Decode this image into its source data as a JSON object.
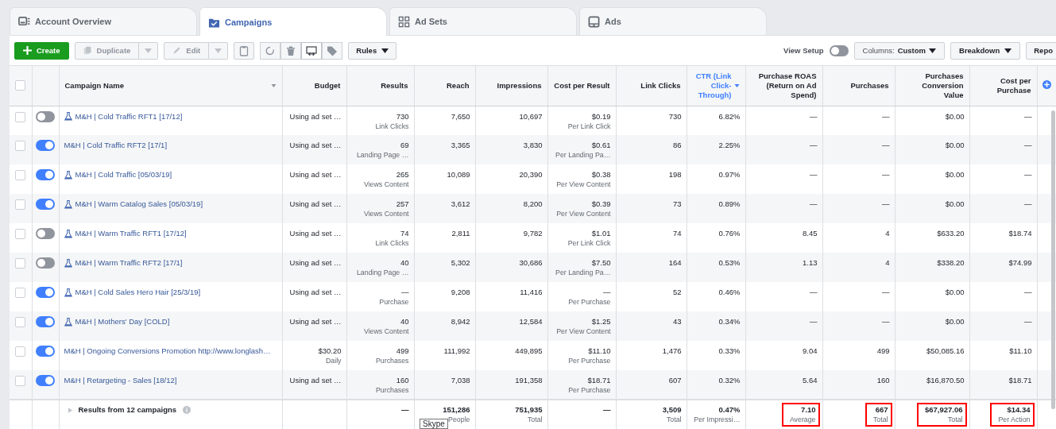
{
  "tabs": [
    {
      "label": "Account Overview",
      "selected": false
    },
    {
      "label": "Campaigns",
      "selected": true
    },
    {
      "label": "Ad Sets",
      "selected": false
    },
    {
      "label": "Ads",
      "selected": false
    }
  ],
  "toolbar": {
    "create": {
      "label": "Create"
    },
    "duplicate": {
      "label": "Duplicate",
      "disabled": true
    },
    "edit": {
      "label": "Edit",
      "disabled": true
    },
    "icon_buttons": [
      {
        "disabled": true
      },
      {
        "disabled": true
      },
      {
        "disabled": true
      },
      {
        "disabled": false
      },
      {
        "disabled": true
      }
    ],
    "rules": {
      "label": "Rules"
    },
    "view_setup": {
      "label": "View Setup",
      "on": false
    },
    "columns": {
      "label": "Columns:",
      "value": "Custom"
    },
    "breakdown": {
      "label": "Breakdown"
    },
    "report": {
      "label": "Repo"
    }
  },
  "table": {
    "header_checkbox": {
      "checked": false
    },
    "columns": [
      {
        "label": "Campaign Name",
        "caret": true,
        "sorted": false
      },
      {
        "label": "Budget",
        "caret": false,
        "sorted": false
      },
      {
        "label": "Results",
        "caret": false,
        "sorted": false
      },
      {
        "label": "Reach",
        "caret": false,
        "sorted": false
      },
      {
        "label": "Impressions",
        "caret": false,
        "sorted": false
      },
      {
        "label": "Cost per Result",
        "caret": false,
        "sorted": false
      },
      {
        "label": "Link Clicks",
        "caret": false,
        "sorted": false
      },
      {
        "label": "CTR (Link Click-Through)",
        "caret": true,
        "sorted": true
      },
      {
        "label": "Purchase ROAS (Return on Ad Spend)",
        "caret": false,
        "sorted": false
      },
      {
        "label": "Purchases",
        "caret": false,
        "sorted": false
      },
      {
        "label": "Purchases Conversion Value",
        "caret": false,
        "sorted": false
      },
      {
        "label": "Cost per Purchase",
        "caret": false,
        "sorted": false
      }
    ],
    "rows": [
      {
        "selected": false,
        "on": false,
        "experiment": true,
        "cells": [
          {
            "value": "M&H | Cold Traffic RFT1 [17/12]"
          },
          {
            "value": "Using ad set …"
          },
          {
            "value": "730",
            "caption": "Link Clicks"
          },
          {
            "value": "7,650"
          },
          {
            "value": "10,697"
          },
          {
            "value": "$0.19",
            "caption": "Per Link Click"
          },
          {
            "value": "730"
          },
          {
            "value": "6.82%"
          },
          {
            "value": "—"
          },
          {
            "value": "—"
          },
          {
            "value": "$0.00"
          },
          {
            "value": "—"
          }
        ]
      },
      {
        "selected": false,
        "on": true,
        "experiment": false,
        "cells": [
          {
            "value": "M&H | Cold Traffic RFT2 [17/1]"
          },
          {
            "value": "Using ad set …"
          },
          {
            "value": "69",
            "caption": "Landing Page …"
          },
          {
            "value": "3,365"
          },
          {
            "value": "3,830"
          },
          {
            "value": "$0.61",
            "caption": "Per Landing Pa…"
          },
          {
            "value": "86"
          },
          {
            "value": "2.25%"
          },
          {
            "value": "—"
          },
          {
            "value": "—"
          },
          {
            "value": "$0.00"
          },
          {
            "value": "—"
          }
        ]
      },
      {
        "selected": false,
        "on": true,
        "experiment": true,
        "cells": [
          {
            "value": "M&H | Cold Traffic [05/03/19]"
          },
          {
            "value": "Using ad set …"
          },
          {
            "value": "265",
            "caption": "Views Content"
          },
          {
            "value": "10,089"
          },
          {
            "value": "20,390"
          },
          {
            "value": "$0.38",
            "caption": "Per View Content"
          },
          {
            "value": "198"
          },
          {
            "value": "0.97%"
          },
          {
            "value": "—"
          },
          {
            "value": "—"
          },
          {
            "value": "$0.00"
          },
          {
            "value": "—"
          }
        ]
      },
      {
        "selected": false,
        "on": true,
        "experiment": true,
        "cells": [
          {
            "value": "M&H | Warm Catalog Sales [05/03/19]"
          },
          {
            "value": "Using ad set …"
          },
          {
            "value": "257",
            "caption": "Views Content"
          },
          {
            "value": "3,612"
          },
          {
            "value": "8,200"
          },
          {
            "value": "$0.39",
            "caption": "Per View Content"
          },
          {
            "value": "73"
          },
          {
            "value": "0.89%"
          },
          {
            "value": "—"
          },
          {
            "value": "—"
          },
          {
            "value": "$0.00"
          },
          {
            "value": "—"
          }
        ]
      },
      {
        "selected": false,
        "on": false,
        "experiment": true,
        "cells": [
          {
            "value": "M&H | Warm Traffic RFT1 [17/12]"
          },
          {
            "value": "Using ad set …"
          },
          {
            "value": "74",
            "caption": "Link Clicks"
          },
          {
            "value": "2,811"
          },
          {
            "value": "9,782"
          },
          {
            "value": "$1.01",
            "caption": "Per Link Click"
          },
          {
            "value": "74"
          },
          {
            "value": "0.76%"
          },
          {
            "value": "8.45"
          },
          {
            "value": "4"
          },
          {
            "value": "$633.20"
          },
          {
            "value": "$18.74"
          }
        ]
      },
      {
        "selected": false,
        "on": false,
        "experiment": true,
        "cells": [
          {
            "value": "M&H | Warm Traffic RFT2 [17/1]"
          },
          {
            "value": "Using ad set …"
          },
          {
            "value": "40",
            "caption": "Landing Page …"
          },
          {
            "value": "5,302"
          },
          {
            "value": "30,686"
          },
          {
            "value": "$7.50",
            "caption": "Per Landing Pa…"
          },
          {
            "value": "164"
          },
          {
            "value": "0.53%"
          },
          {
            "value": "1.13"
          },
          {
            "value": "4"
          },
          {
            "value": "$338.20"
          },
          {
            "value": "$74.99"
          }
        ]
      },
      {
        "selected": false,
        "on": true,
        "experiment": true,
        "cells": [
          {
            "value": "M&H | Cold Sales Hero Hair [25/3/19]"
          },
          {
            "value": "Using ad set …"
          },
          {
            "value": "—",
            "caption": "Purchase"
          },
          {
            "value": "9,208"
          },
          {
            "value": "11,416"
          },
          {
            "value": "—",
            "caption": "Per Purchase"
          },
          {
            "value": "52"
          },
          {
            "value": "0.46%"
          },
          {
            "value": "—"
          },
          {
            "value": "—"
          },
          {
            "value": "$0.00"
          },
          {
            "value": "—"
          }
        ]
      },
      {
        "selected": false,
        "on": true,
        "experiment": true,
        "cells": [
          {
            "value": "M&H | Mothers' Day [COLD]"
          },
          {
            "value": "Using ad set …"
          },
          {
            "value": "40",
            "caption": "Views Content"
          },
          {
            "value": "8,942"
          },
          {
            "value": "12,584"
          },
          {
            "value": "$1.25",
            "caption": "Per View Content"
          },
          {
            "value": "43"
          },
          {
            "value": "0.34%"
          },
          {
            "value": "—"
          },
          {
            "value": "—"
          },
          {
            "value": "$0.00"
          },
          {
            "value": "—"
          }
        ]
      },
      {
        "selected": false,
        "on": true,
        "experiment": false,
        "cells": [
          {
            "value": "M&H | Ongoing Conversions Promotion http://www.longlash…"
          },
          {
            "value": "$30.20",
            "caption": "Daily"
          },
          {
            "value": "499",
            "caption": "Purchases"
          },
          {
            "value": "111,992"
          },
          {
            "value": "449,895"
          },
          {
            "value": "$11.10",
            "caption": "Per Purchase"
          },
          {
            "value": "1,476"
          },
          {
            "value": "0.33%"
          },
          {
            "value": "9.04"
          },
          {
            "value": "499"
          },
          {
            "value": "$50,085.16"
          },
          {
            "value": "$11.10"
          }
        ]
      },
      {
        "selected": false,
        "on": true,
        "experiment": false,
        "cells": [
          {
            "value": "M&H | Retargeting - Sales [18/12]"
          },
          {
            "value": "Using ad set …"
          },
          {
            "value": "160",
            "caption": "Purchases"
          },
          {
            "value": "7,038"
          },
          {
            "value": "191,358"
          },
          {
            "value": "$18.71",
            "caption": "Per Purchase"
          },
          {
            "value": "607"
          },
          {
            "value": "0.32%"
          },
          {
            "value": "5.64"
          },
          {
            "value": "160"
          },
          {
            "value": "$16,870.50"
          },
          {
            "value": "$18.71"
          }
        ]
      }
    ],
    "summary": {
      "cells": [
        {
          "value": "Results from 12 campaigns",
          "highlighted": false
        },
        {
          "highlighted": false
        },
        {
          "value": "—",
          "highlighted": false
        },
        {
          "value": "151,286",
          "caption": "People",
          "highlighted": false
        },
        {
          "value": "751,935",
          "caption": "Total",
          "highlighted": false
        },
        {
          "value": "—",
          "highlighted": false
        },
        {
          "value": "3,509",
          "caption": "Total",
          "highlighted": false
        },
        {
          "value": "0.47%",
          "caption": "Per Impressi…",
          "highlighted": false
        },
        {
          "value": "7.10",
          "caption": "Average",
          "highlighted": true
        },
        {
          "value": "667",
          "caption": "Total",
          "highlighted": true
        },
        {
          "value": "$67,927.06",
          "caption": "Total",
          "highlighted": true
        },
        {
          "value": "$14.34",
          "caption": "Per Action",
          "highlighted": true
        }
      ]
    }
  },
  "tooltip": {
    "text": "Skype"
  }
}
